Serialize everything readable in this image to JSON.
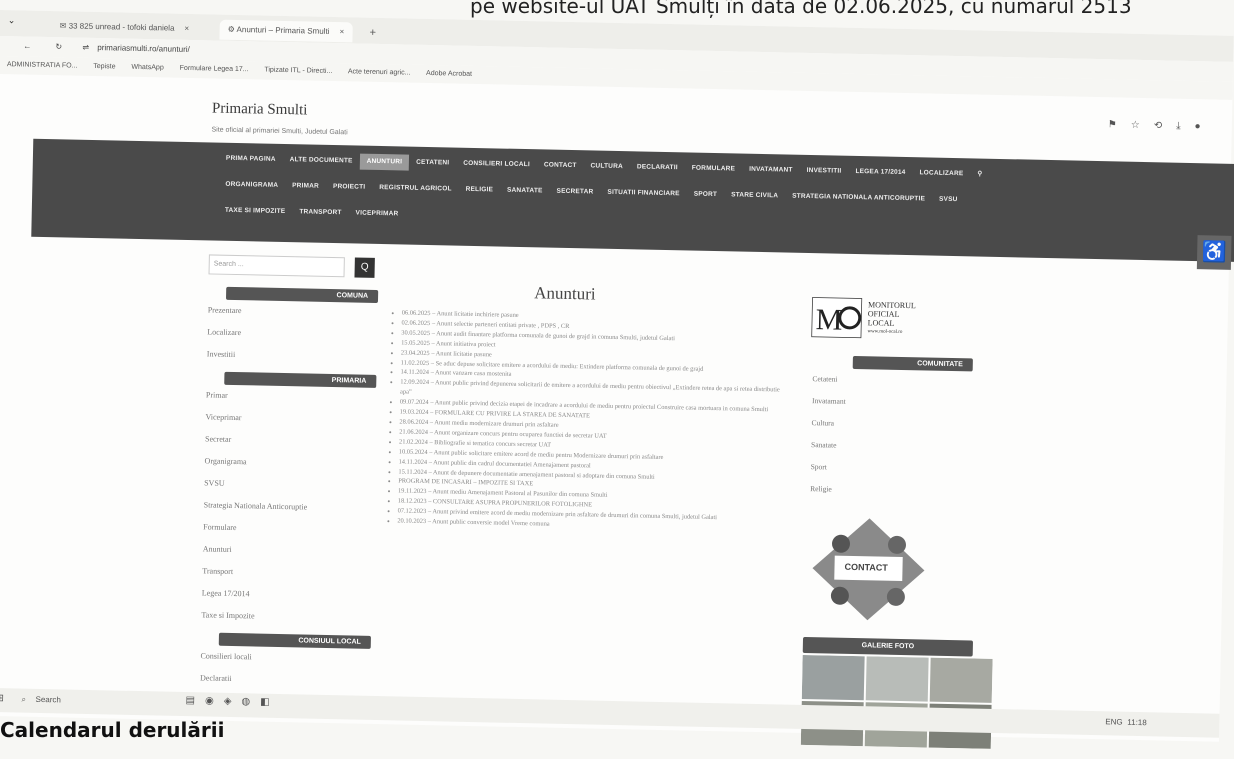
{
  "paper": {
    "top_text": "pe website-ul UAT Smulți în data de 02.06.2025, cu numărul 2513",
    "bottom_text": "Calendarul derulării"
  },
  "browser": {
    "tabs": [
      {
        "label": "33 825 unread - tofoki daniela"
      },
      {
        "label": "Anunturi – Primaria Smulti"
      }
    ],
    "new_tab": "+",
    "url": "primariasmulti.ro/anunturi/",
    "bookmarks": [
      "ADMINISTRATIA FO...",
      "Tepiste",
      "WhatsApp",
      "Formulare Legea 17...",
      "Tipizate ITL - Directi...",
      "Acte terenuri agric...",
      "Adobe Acrobat"
    ],
    "close_glyph": "×",
    "window_min": "–"
  },
  "site": {
    "title": "Primaria Smulti",
    "subtitle": "Site oficial al primariei Smulti, Judetul Galati"
  },
  "nav": {
    "row1": [
      "PRIMA PAGINA",
      "ALTE DOCUMENTE",
      "ANUNTURI",
      "CETATENI",
      "CONSILIERI LOCALI",
      "CONTACT",
      "CULTURA",
      "DECLARATII",
      "FORMULARE",
      "INVATAMANT",
      "INVESTITII",
      "LEGEA 17/2014",
      "LOCALIZARE"
    ],
    "row2": [
      "ORGANIGRAMA",
      "PRIMAR",
      "PROIECTI",
      "REGISTRUL AGRICOL",
      "RELIGIE",
      "SANATATE",
      "SECRETAR",
      "SITUATII FINANCIARE",
      "SPORT",
      "STARE CIVILA",
      "STRATEGIA NATIONALA ANTICORUPTIE",
      "SVSU"
    ],
    "row3": [
      "TAXE SI IMPOZITE",
      "TRANSPORT",
      "VICEPRIMAR"
    ],
    "search_glyph": "⚲"
  },
  "sidebar": {
    "search_placeholder": "Search ...",
    "search_btn": "Q",
    "sections": [
      {
        "header": "COMUNA",
        "links": [
          "Prezentare",
          "Localizare",
          "Investitii"
        ]
      },
      {
        "header": "PRIMARIA",
        "links": [
          "Primar",
          "Viceprimar",
          "Secretar",
          "Organigrama",
          "SVSU",
          "Strategia Nationala Anticoruptie",
          "Formulare",
          "Anunturi",
          "Transport",
          "Legea 17/2014",
          "Taxe si Impozite"
        ]
      },
      {
        "header": "CONSIUUL LOCAL",
        "links": [
          "Consilieri locali",
          "Declaratii"
        ]
      }
    ]
  },
  "main": {
    "title": "Anunturi",
    "items": [
      "06.06.2025 – Anunt licitatie inchiriere pasune",
      "02.06.2025 – Anunt selectie parteneri entitati private , PDPS , CR",
      "30.05.2025 – Anunt audit finantare platforma comunala de gunoi de grajd in comuna Smulti, judetul Galati",
      "15.05.2025 – Anunt initiativa proiect",
      "23.04.2025 – Anunt licitatie pasune",
      "11.02.2025 – Se aduc depuse solicitare emitere a acordului de mediu: Extindere platforma comunala de gunoi de grajd",
      "14.11.2024 – Anunt vanzare casa mostenita",
      "12.09.2024 – Anunt public privind depunerea solicitarii de emitere a acordului de mediu pentru obiectivul „Extindere retea de apa si retea distributie apa”",
      "09.07.2024 – Anunt public privind decizia etapei de incadrare a acordului de mediu pentru proiectul Construire casa mortuara in comuna Smulti",
      "19.03.2024 – FORMULARE CU PRIVIRE LA STAREA DE SANATATE",
      "28.06.2024 – Anunt mediu modernizare drumuri prin asfaltare",
      "21.06.2024 – Anunt organizare concurs pentru ocuparea functiei de secretar UAT",
      "21.02.2024 – Bibliografie si tematica concurs secretar UAT",
      "10.05.2024 – Anunt public solicitare emitere acord de mediu pentru Modernizare drumuri prin asfaltare",
      "14.11.2024 – Anunt public din cadrul documentatiei Amenajament pastoral",
      "15.11.2024 – Anunt de depunere documentatie amenajament pastoral si adoptare din comuna Smulti",
      "PROGRAM DE INCASARI – IMPOZITE SI TAXE",
      "19.11.2023 – Anunt mediu Amenajament Pastoral al Pasunilor din comuna Smulti",
      "18.12.2023 – CONSULTARE ASUPRA PROPUNERILOR FOTOLIGHNE",
      "07.12.2023 – Anunt privind emitere acord de mediu modernizare prin asfaltare de drumuri din comuna Smulti, judetul Galati",
      "20.10.2023 – Anunt public conversie model Vreme comuna"
    ]
  },
  "right": {
    "mol": {
      "line1": "MONITORUL",
      "line2": "OFICIAL",
      "line3": "LOCAL",
      "url": "www.mol-ocal.ro"
    },
    "community_header": "COMUNITATE",
    "community_links": [
      "Cetateni",
      "Invatamant",
      "Cultura",
      "Sanatate",
      "Sport",
      "Religie"
    ],
    "contact_label": "CONTACT",
    "gallery_header": "GALERIE FOTO"
  },
  "taskbar": {
    "search_label": "Search",
    "time": "11:18",
    "lang": "ENG"
  },
  "colors": {
    "nav_bg": "#4a4a4a",
    "accent": "#555555"
  }
}
